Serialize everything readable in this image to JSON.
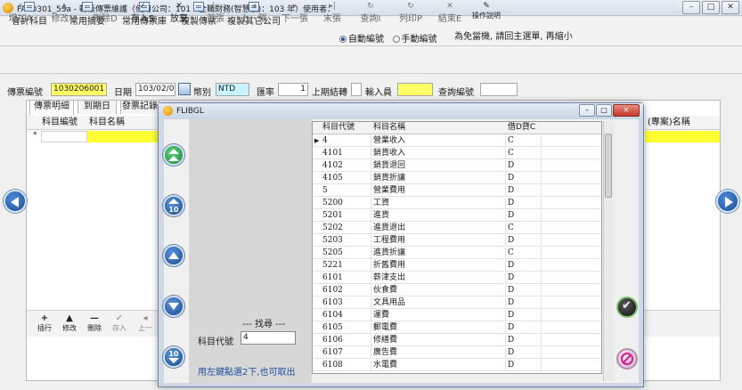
{
  "window": {
    "title": "FAC0301_53a - 轉帳傳票維護（使用公司：101 - 全職財務(智慧版)：103 年）使用者：",
    "btn_min": "–",
    "btn_max": "□",
    "btn_close": "✕"
  },
  "toolbar1": {
    "items": [
      "會計科目",
      "常用摘要",
      "常用傳票庫",
      "複製傳票",
      "複製其它公司"
    ],
    "radio_auto": "自動編號",
    "radio_manual": "手動編號",
    "hint": "為免當機, 請回主選單, 再縮小"
  },
  "toolbar2": {
    "items": [
      {
        "label": "增加A",
        "glyph": "+"
      },
      {
        "label": "修改M",
        "glyph": "▲"
      },
      {
        "label": "刪除D",
        "glyph": "—"
      },
      {
        "label": "存入S",
        "glyph": "✓"
      },
      {
        "label": "放棄",
        "glyph": "✕"
      },
      {
        "label": "首張",
        "glyph": "|◂"
      },
      {
        "label": "上一張",
        "glyph": "◂"
      },
      {
        "label": "下一張",
        "glyph": "▸"
      },
      {
        "label": "末張",
        "glyph": "▸|"
      },
      {
        "label": "查詢I",
        "glyph": "↻"
      },
      {
        "label": "列印P",
        "glyph": "↻"
      },
      {
        "label": "結束E",
        "glyph": "✕"
      },
      {
        "label": "操作說明",
        "glyph": "✎"
      }
    ]
  },
  "form": {
    "voucher_no_label": "傳票編號",
    "voucher_no": "1030206001",
    "date_label": "日期",
    "date": "103/02/06",
    "currency_label": "幣別",
    "currency": "NTD",
    "rate_label": "匯率",
    "rate": "1",
    "last_close_label": "上期結轉",
    "entry_user_label": "輸入員",
    "query_no_label": "查詢編號"
  },
  "tabs": [
    "傳票明細",
    "到期日",
    "發票記錄"
  ],
  "grid": {
    "col_code": "科目編號",
    "col_name": "科目名稱",
    "col_right": "(專案)名稱",
    "new_row_marker": "*"
  },
  "bottom_bar": {
    "items": [
      {
        "label": "插行",
        "glyph": "+"
      },
      {
        "label": "修改",
        "glyph": "▲"
      },
      {
        "label": "刪除",
        "glyph": "—"
      },
      {
        "label": "存入",
        "glyph": "✓"
      },
      {
        "label": "上一",
        "glyph": "◂"
      }
    ]
  },
  "dialog": {
    "title": "FLIBGL",
    "nav_page_up_label": "10",
    "nav_page_down_label": "10",
    "find_title": "--- 找尋 ---",
    "find_field_label": "科目代號",
    "find_value": "4",
    "hint": "用左鍵點選2下,也可取出",
    "table": {
      "headers": [
        "科目代號",
        "科目名稱",
        "借D貸C"
      ],
      "current_marker": "▶",
      "rows": [
        [
          "4",
          "營業收入",
          "C"
        ],
        [
          "4101",
          "銷貨收入",
          "C"
        ],
        [
          "4102",
          "銷貨退回",
          "D"
        ],
        [
          "4105",
          "銷貨折讓",
          "D"
        ],
        [
          "5",
          "營業費用",
          "D"
        ],
        [
          "5200",
          "工資",
          "D"
        ],
        [
          "5201",
          "進貨",
          "D"
        ],
        [
          "5202",
          "進貨退出",
          "C"
        ],
        [
          "5203",
          "工程費用",
          "D"
        ],
        [
          "5205",
          "進貨折讓",
          "C"
        ],
        [
          "5221",
          "折舊費用",
          "D"
        ],
        [
          "6101",
          "薪津支出",
          "D"
        ],
        [
          "6102",
          "伙食費",
          "D"
        ],
        [
          "6103",
          "文具用品",
          "D"
        ],
        [
          "6104",
          "運費",
          "D"
        ],
        [
          "6105",
          "郵電費",
          "D"
        ],
        [
          "6106",
          "修繕費",
          "D"
        ],
        [
          "6107",
          "廣告費",
          "D"
        ],
        [
          "6108",
          "水電費",
          "D"
        ]
      ]
    }
  }
}
